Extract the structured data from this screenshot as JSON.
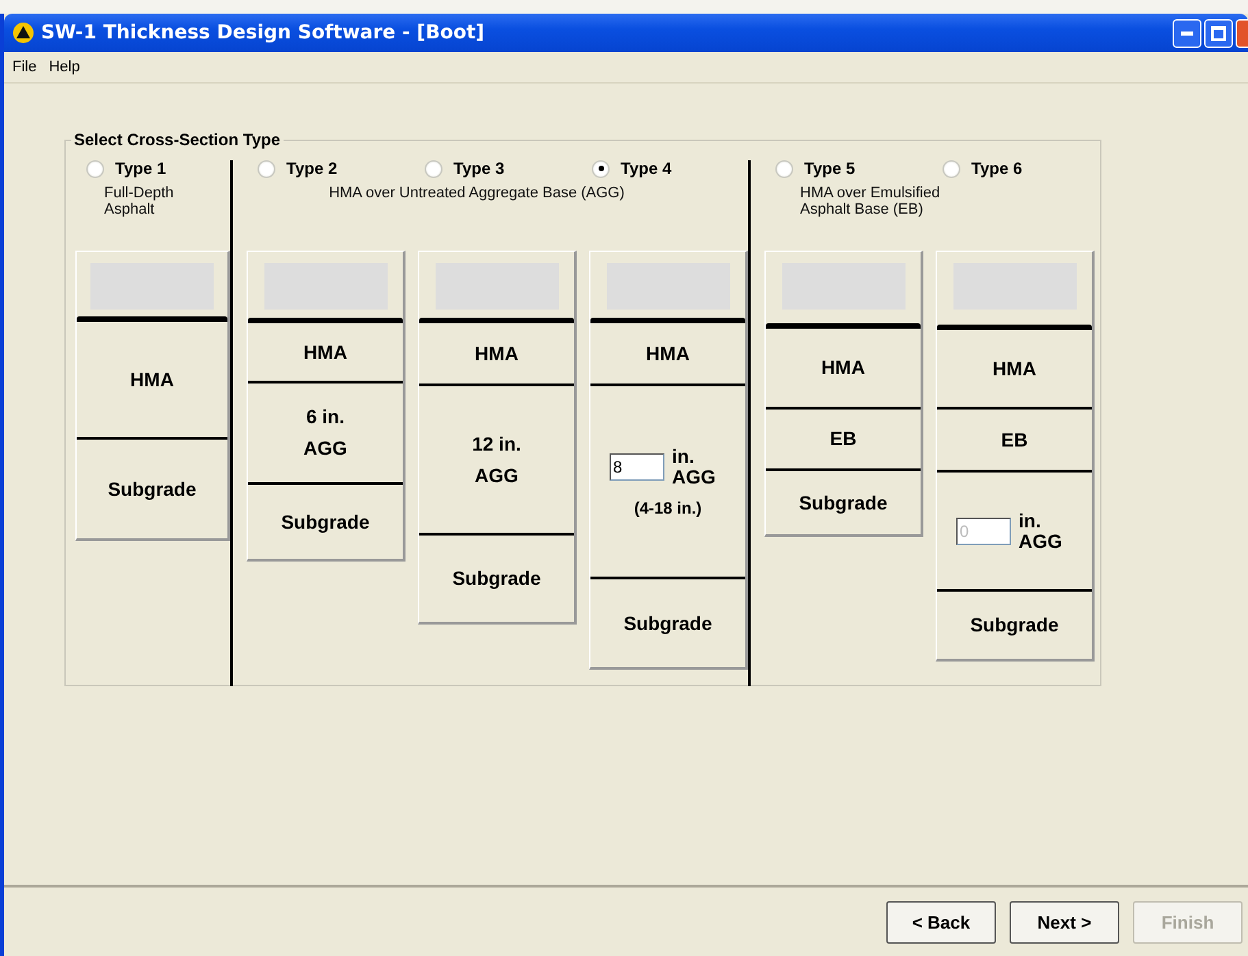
{
  "window": {
    "title": "SW-1 Thickness Design Software - [Boot]"
  },
  "menu": [
    "File",
    "Help"
  ],
  "group": {
    "title": "Select Cross-Section Type",
    "sections": [
      {
        "description": "Full-Depth Asphalt",
        "types": [
          {
            "label": "Type 1",
            "selected": false,
            "layers": [
              {
                "kind": "text",
                "lines": [
                  "HMA"
                ]
              },
              {
                "kind": "text",
                "lines": [
                  "Subgrade"
                ]
              }
            ]
          }
        ]
      },
      {
        "description": "HMA over Untreated Aggregate Base (AGG)",
        "types": [
          {
            "label": "Type 2",
            "selected": false,
            "layers": [
              {
                "kind": "text",
                "lines": [
                  "HMA"
                ]
              },
              {
                "kind": "text",
                "lines": [
                  "6 in.",
                  "AGG"
                ]
              },
              {
                "kind": "text",
                "lines": [
                  "Subgrade"
                ]
              }
            ]
          },
          {
            "label": "Type 3",
            "selected": false,
            "layers": [
              {
                "kind": "text",
                "lines": [
                  "HMA"
                ]
              },
              {
                "kind": "text",
                "lines": [
                  "12 in.",
                  "AGG"
                ]
              },
              {
                "kind": "text",
                "lines": [
                  "Subgrade"
                ]
              }
            ]
          },
          {
            "label": "Type 4",
            "selected": true,
            "layers": [
              {
                "kind": "text",
                "lines": [
                  "HMA"
                ]
              },
              {
                "kind": "input",
                "value": "8",
                "disabled": false,
                "unit": [
                  "in.",
                  "AGG"
                ],
                "note": "(4-18 in.)"
              },
              {
                "kind": "text",
                "lines": [
                  "Subgrade"
                ]
              }
            ]
          }
        ]
      },
      {
        "description": "HMA over Emulsified Asphalt Base (EB)",
        "types": [
          {
            "label": "Type 5",
            "selected": false,
            "layers": [
              {
                "kind": "text",
                "lines": [
                  "HMA"
                ]
              },
              {
                "kind": "text",
                "lines": [
                  "EB"
                ]
              },
              {
                "kind": "text",
                "lines": [
                  "Subgrade"
                ]
              }
            ]
          },
          {
            "label": "Type 6",
            "selected": false,
            "layers": [
              {
                "kind": "text",
                "lines": [
                  "HMA"
                ]
              },
              {
                "kind": "text",
                "lines": [
                  "EB"
                ]
              },
              {
                "kind": "input",
                "value": "0",
                "disabled": true,
                "unit": [
                  "in.",
                  "AGG"
                ]
              },
              {
                "kind": "text",
                "lines": [
                  "Subgrade"
                ]
              }
            ]
          }
        ]
      }
    ]
  },
  "buttons": [
    {
      "label": "< Back",
      "disabled": false
    },
    {
      "label": "Next >",
      "disabled": false
    },
    {
      "label": "Finish",
      "disabled": true
    }
  ]
}
